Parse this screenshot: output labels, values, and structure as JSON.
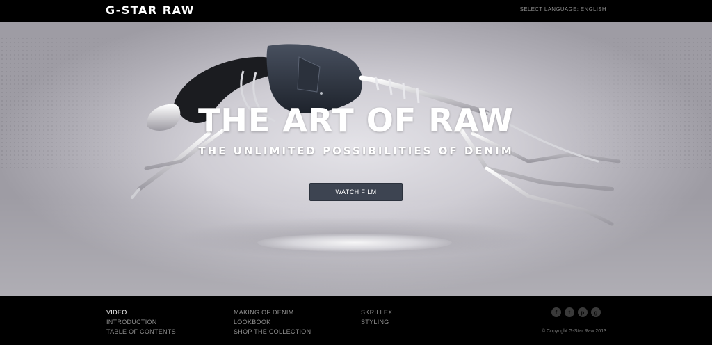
{
  "header": {
    "logo": "G-STAR RAW",
    "language": "SELECT LANGUAGE: ENGLISH"
  },
  "hero": {
    "title": "THE ART OF RAW",
    "subtitle": "THE UNLIMITED POSSIBILITIES OF DENIM",
    "cta_label": "WATCH FILM"
  },
  "footer": {
    "col1": [
      {
        "label": "VIDEO",
        "active": true
      },
      {
        "label": "INTRODUCTION",
        "active": false
      },
      {
        "label": "TABLE OF CONTENTS",
        "active": false
      }
    ],
    "col2": [
      {
        "label": "MAKING OF DENIM"
      },
      {
        "label": "LOOKBOOK"
      },
      {
        "label": "SHOP THE COLLECTION"
      }
    ],
    "col3": [
      {
        "label": "SKRILLEX"
      },
      {
        "label": "STYLING"
      }
    ],
    "social": [
      {
        "icon": "facebook-icon",
        "glyph": "f"
      },
      {
        "icon": "twitter-icon",
        "glyph": "t"
      },
      {
        "icon": "pinterest-icon",
        "glyph": "p"
      },
      {
        "icon": "google-plus-icon",
        "glyph": "g"
      }
    ],
    "copyright": "© Copyright G-Star Raw 2013"
  },
  "colors": {
    "button_bg": "#3d4451",
    "footer_link": "#8d8d8d",
    "footer_active": "#ffffff"
  }
}
